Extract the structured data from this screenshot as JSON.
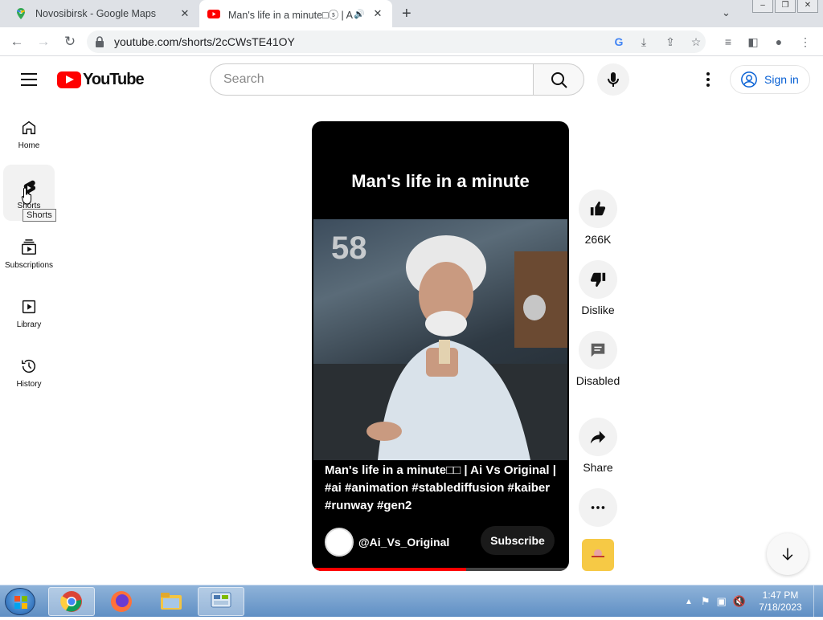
{
  "browser": {
    "tabs": [
      {
        "title": "Novosibirsk - Google Maps"
      },
      {
        "title": "Man's life in a minute□ⓢ | A"
      }
    ],
    "url": "youtube.com/shorts/2cCWsTE41OY"
  },
  "header": {
    "logo_text": "YouTube",
    "search_placeholder": "Search",
    "sign_in": "Sign in"
  },
  "sidebar": {
    "items": [
      {
        "label": "Home"
      },
      {
        "label": "Shorts"
      },
      {
        "label": "Subscriptions"
      },
      {
        "label": "Library"
      },
      {
        "label": "History"
      }
    ],
    "tooltip": "Shorts"
  },
  "short": {
    "overlay_title": "Man's life in a minute",
    "counter": "58",
    "caption": "Man's life in a minute□□ | Ai Vs Original | #ai #animation #stablediffusion #kaiber #runway #gen2",
    "channel": "@Ai_Vs_Original",
    "subscribe": "Subscribe",
    "progress": 0.6
  },
  "actions": {
    "likes": "266K",
    "dislike": "Dislike",
    "comments": "Disabled",
    "share": "Share"
  },
  "taskbar": {
    "time": "1:47 PM",
    "date": "7/18/2023"
  }
}
